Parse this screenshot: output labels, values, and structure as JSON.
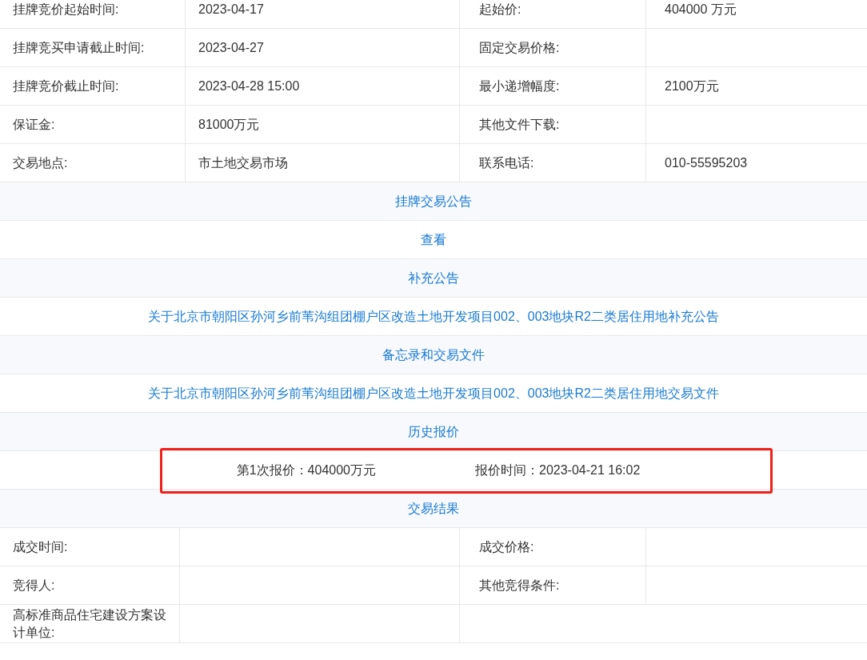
{
  "info_rows": [
    {
      "label": "挂牌竞价起始时间:",
      "value": "2023-04-17",
      "label_2": "起始价:",
      "value_2": "404000 万元"
    },
    {
      "label": "挂牌竞买申请截止时间:",
      "value": "2023-04-27",
      "label_2": "固定交易价格:"
    },
    {
      "label": "挂牌竞价截止时间:",
      "value": "2023-04-28 15:00",
      "label_2": "最小递增幅度:",
      "value_2": "2100万元"
    },
    {
      "label": "保证金:",
      "value": "81000万元",
      "label_2": "其他文件下载:"
    },
    {
      "label": "交易地点:",
      "value": "市土地交易市场",
      "label_2": "联系电话:",
      "value_2": "010-55595203"
    }
  ],
  "sections": [
    {
      "kind": "heading",
      "text": "挂牌交易公告"
    },
    {
      "kind": "link",
      "text": "查看"
    },
    {
      "kind": "heading",
      "text": "补充公告"
    },
    {
      "kind": "link",
      "text": "关于北京市朝阳区孙河乡前苇沟组团棚户区改造土地开发项目002、003地块R2二类居住用地补充公告"
    },
    {
      "kind": "heading",
      "text": "备忘录和交易文件"
    },
    {
      "kind": "link",
      "text": "关于北京市朝阳区孙河乡前苇沟组团棚户区改造土地开发项目002、003地块R2二类居住用地交易文件"
    },
    {
      "kind": "heading",
      "text": "历史报价"
    },
    {
      "kind": "quote",
      "bid": "第1次报价：404000万元",
      "time": "报价时间：2023-04-21 16:02",
      "highlighted": true
    },
    {
      "kind": "heading",
      "text": "交易结果"
    }
  ],
  "result_rows": [
    {
      "kind": "pair",
      "label": "成交时间:",
      "label_2": "成交价格:"
    },
    {
      "kind": "pair",
      "label": "竞得人:",
      "label_2": "其他竞得条件:"
    },
    {
      "kind": "single",
      "label": "高标准商品住宅建设方案设计单位:"
    }
  ]
}
